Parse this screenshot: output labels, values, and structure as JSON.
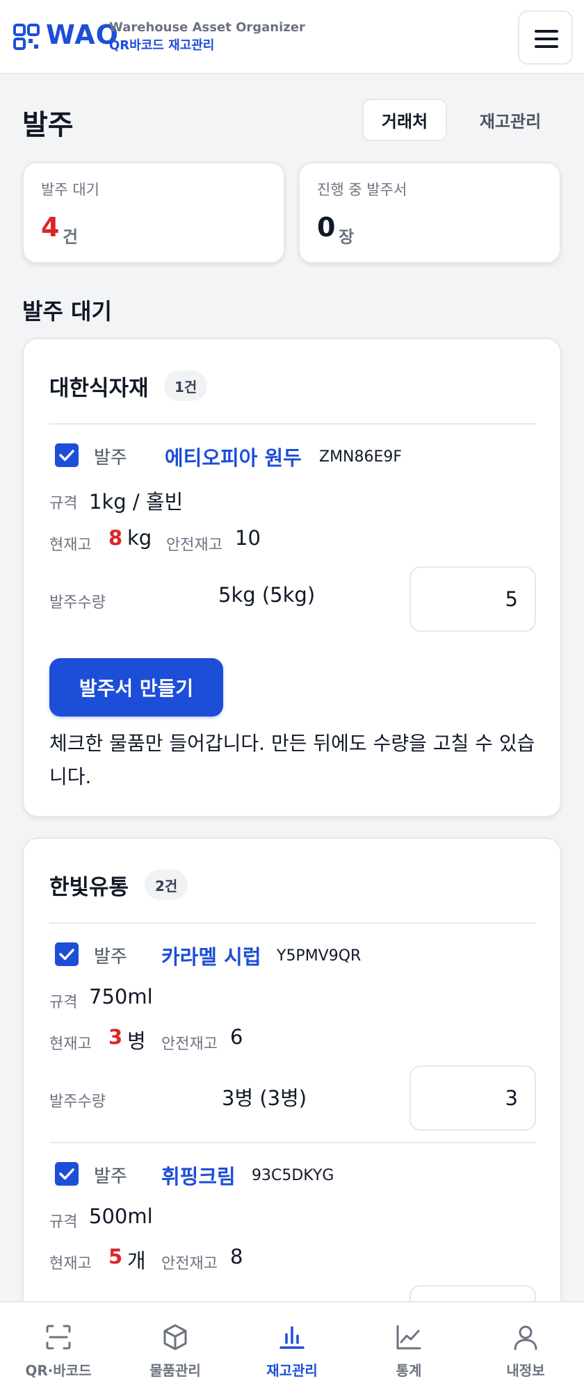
{
  "header": {
    "brand": "WAO",
    "subtitle_line1": "Warehouse Asset Organizer",
    "subtitle_line2": "QR바코드 재고관리",
    "menu_icon": "hamburger-menu-icon"
  },
  "page": {
    "title": "발주",
    "tabs": [
      {
        "label": "거래처",
        "selected": true
      },
      {
        "label": "재고관리",
        "selected": false
      }
    ]
  },
  "stats": {
    "pending": {
      "label": "발주 대기",
      "value": "4",
      "unit": "건"
    },
    "in_progress": {
      "label": "진행 중 발주서",
      "value": "0",
      "unit": "장"
    }
  },
  "section": {
    "title": "발주 대기"
  },
  "common": {
    "check_label": "발주",
    "spec_label": "규격",
    "stock_label": "현재고",
    "safety_label": "안전재고",
    "qty_label": "발주수량",
    "make_button": "발주서 만들기",
    "help": "체크한 물품만 들어갑니다. 만든 뒤에도 수량을 고칠 수 있습니다."
  },
  "suppliers": [
    {
      "name": "대한식자재",
      "count": "1건",
      "items": [
        {
          "checked": true,
          "name": "에티오피아 원두",
          "code": "ZMN86E9F",
          "spec": "1kg / 홀빈",
          "stock": "8",
          "stock_unit": "kg",
          "safety": "10",
          "qty_text": "5kg (5kg)",
          "qty_value": "5"
        }
      ]
    },
    {
      "name": "한빛유통",
      "count": "2건",
      "items": [
        {
          "checked": true,
          "name": "카라멜 시럽",
          "code": "Y5PMV9QR",
          "spec": "750ml",
          "stock": "3",
          "stock_unit": "병",
          "safety": "6",
          "qty_text": "3병 (3병)",
          "qty_value": "3"
        },
        {
          "checked": true,
          "name": "휘핑크림",
          "code": "93C5DKYG",
          "spec": "500ml",
          "stock": "5",
          "stock_unit": "개",
          "safety": "8",
          "qty_text": "",
          "qty_value": ""
        }
      ]
    }
  ],
  "bottom_nav": [
    {
      "label": "QR·바코드",
      "icon": "qr-scan-icon",
      "active": false
    },
    {
      "label": "물품관리",
      "icon": "box-icon",
      "active": false
    },
    {
      "label": "재고관리",
      "icon": "bar-chart-icon",
      "active": true
    },
    {
      "label": "통계",
      "icon": "line-chart-icon",
      "active": false
    },
    {
      "label": "내정보",
      "icon": "user-icon",
      "active": false
    }
  ],
  "colors": {
    "accent": "#1d4ed8",
    "danger": "#dc2626",
    "muted": "#6b7280",
    "background": "#f3f4f6"
  }
}
